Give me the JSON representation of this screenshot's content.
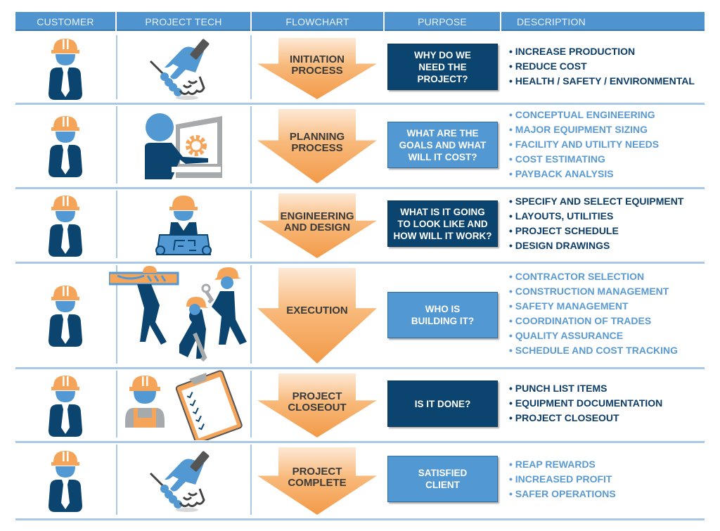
{
  "colors": {
    "header_bg": "#4f93cf",
    "dark_blue": "#0c4470",
    "light_blue": "#5298d3",
    "orange": "#f5a55a",
    "separator": "#a9c8e6"
  },
  "header": {
    "columns": [
      "CUSTOMER",
      "PROJECT TECH",
      "FLOWCHART",
      "PURPOSE",
      "DESCRIPTION"
    ]
  },
  "rows": [
    {
      "customer_icon": "customer-hardhat-icon",
      "tech_icon": "handshake-icon",
      "flowchart_step": [
        "INITIATION",
        "PROCESS"
      ],
      "purpose": [
        "WHY DO WE",
        "NEED THE",
        "PROJECT?"
      ],
      "purpose_style": "dark",
      "description_style": "dark",
      "description": [
        "INCREASE PRODUCTION",
        "REDUCE COST",
        "HEALTH / SAFETY / ENVIRONMENTAL"
      ]
    },
    {
      "customer_icon": "customer-hardhat-icon",
      "tech_icon": "computer-engineer-icon",
      "flowchart_step": [
        "PLANNING",
        "PROCESS"
      ],
      "purpose": [
        "WHAT ARE THE",
        "GOALS AND WHAT",
        "WILL IT COST?"
      ],
      "purpose_style": "light",
      "description_style": "light",
      "description": [
        "CONCEPTUAL ENGINEERING",
        "MAJOR EQUIPMENT SIZING",
        "FACILITY AND UTILITY NEEDS",
        "COST ESTIMATING",
        "PAYBACK ANALYSIS"
      ]
    },
    {
      "customer_icon": "customer-hardhat-icon",
      "tech_icon": "blueprint-engineer-icon",
      "flowchart_step": [
        "ENGINEERING",
        "AND DESIGN"
      ],
      "purpose": [
        "WHAT IS IT GOING",
        "TO LOOK LIKE AND",
        "HOW WILL IT WORK?"
      ],
      "purpose_style": "dark",
      "description_style": "dark",
      "description": [
        "SPECIFY AND SELECT EQUIPMENT",
        "LAYOUTS, UTILITIES",
        "PROJECT SCHEDULE",
        "DESIGN DRAWINGS"
      ]
    },
    {
      "customer_icon": "customer-hardhat-icon",
      "tech_icon": "construction-workers-icon",
      "flowchart_step": [
        "EXECUTION"
      ],
      "purpose": [
        "WHO IS",
        "BUILDING IT?"
      ],
      "purpose_style": "light",
      "description_style": "light",
      "description": [
        "CONTRACTOR SELECTION",
        "CONSTRUCTION MANAGEMENT",
        "SAFETY MANAGEMENT",
        "COORDINATION OF TRADES",
        "QUALITY ASSURANCE",
        "SCHEDULE AND COST TRACKING"
      ]
    },
    {
      "customer_icon": "customer-hardhat-icon",
      "tech_icon": "worker-checklist-icon",
      "flowchart_step": [
        "PROJECT",
        "CLOSEOUT"
      ],
      "purpose": [
        "IS IT DONE?"
      ],
      "purpose_style": "dark",
      "description_style": "dark",
      "description": [
        "PUNCH LIST ITEMS",
        "EQUIPMENT DOCUMENTATION",
        "PROJECT CLOSEOUT"
      ]
    },
    {
      "customer_icon": "customer-hardhat-icon",
      "tech_icon": "handshake-icon",
      "flowchart_step": [
        "PROJECT",
        "COMPLETE"
      ],
      "purpose": [
        "SATISFIED",
        "CLIENT"
      ],
      "purpose_style": "light",
      "description_style": "light",
      "description": [
        "REAP REWARDS",
        "INCREASED PROFIT",
        "SAFER OPERATIONS"
      ]
    }
  ]
}
